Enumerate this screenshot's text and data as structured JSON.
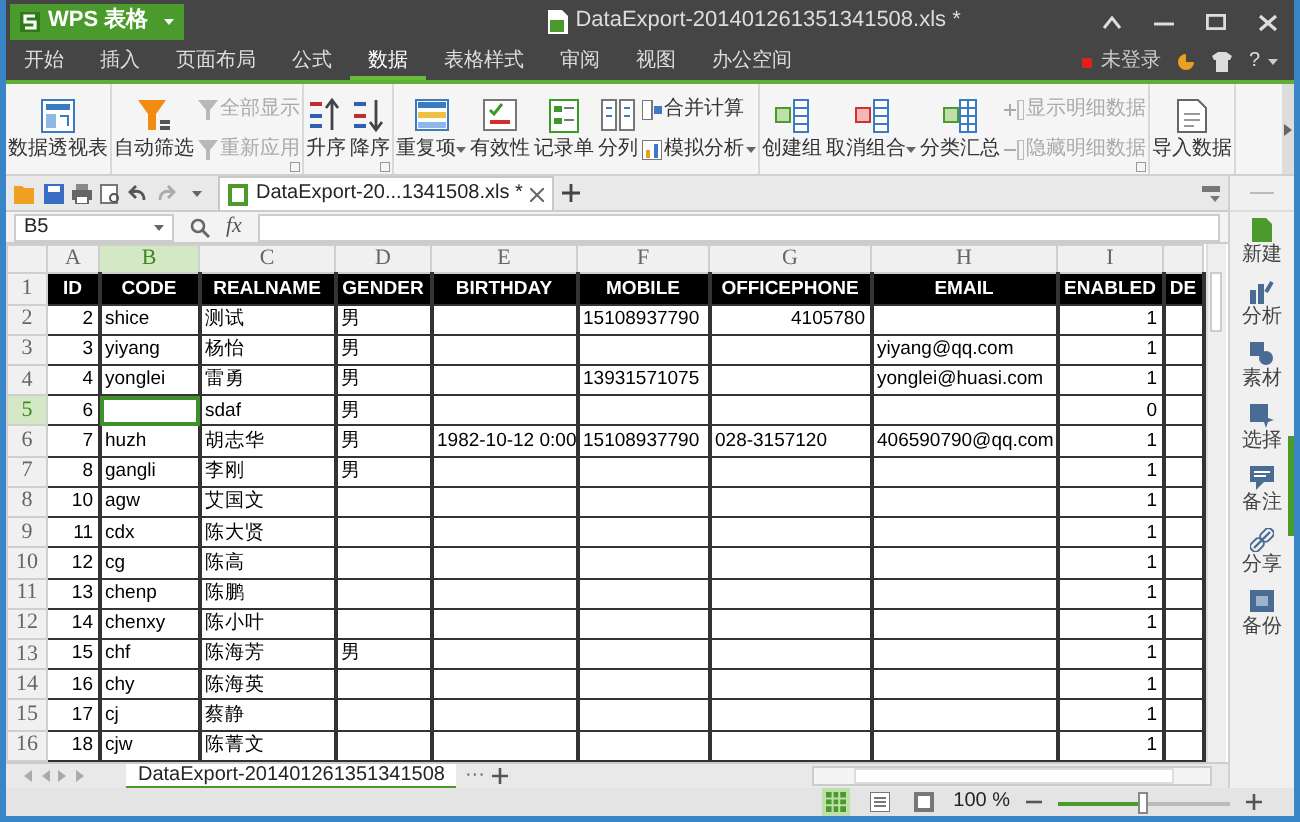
{
  "window": {
    "app_button": "WPS 表格",
    "title": "DataExport-201401261351341508.xls *"
  },
  "menu_tabs": [
    {
      "label": "开始",
      "selected": false
    },
    {
      "label": "插入",
      "selected": false
    },
    {
      "label": "页面布局",
      "selected": false
    },
    {
      "label": "公式",
      "selected": false
    },
    {
      "label": "数据",
      "selected": true
    },
    {
      "label": "表格样式",
      "selected": false
    },
    {
      "label": "审阅",
      "selected": false
    },
    {
      "label": "视图",
      "selected": false
    },
    {
      "label": "办公空间",
      "selected": false
    }
  ],
  "account": {
    "login": "未登录",
    "help": "?"
  },
  "ribbon": {
    "groups": [
      {
        "items": [
          {
            "label": "数据透视表",
            "kind": "large"
          }
        ]
      },
      {
        "launcher": true,
        "items": [
          {
            "label": "自动筛选",
            "kind": "large"
          },
          {
            "label": "全部显示",
            "kind": "small",
            "disabled": true
          },
          {
            "label": "重新应用",
            "kind": "small",
            "disabled": true
          }
        ]
      },
      {
        "launcher": true,
        "items": [
          {
            "label": "升序",
            "kind": "large"
          },
          {
            "label": "降序",
            "kind": "large"
          }
        ]
      },
      {
        "items": [
          {
            "label": "重复项",
            "kind": "large",
            "dropdown": true
          },
          {
            "label": "有效性",
            "kind": "large"
          },
          {
            "label": "记录单",
            "kind": "large"
          },
          {
            "label": "分列",
            "kind": "large"
          },
          {
            "label": "合并计算",
            "kind": "small"
          },
          {
            "label": "模拟分析",
            "kind": "small",
            "dropdown": true
          }
        ]
      },
      {
        "launcher": true,
        "items": [
          {
            "label": "创建组",
            "kind": "large"
          },
          {
            "label": "取消组合",
            "kind": "large",
            "dropdown": true
          },
          {
            "label": "分类汇总",
            "kind": "large"
          },
          {
            "label": "显示明细数据",
            "kind": "small",
            "disabled": true
          },
          {
            "label": "隐藏明细数据",
            "kind": "small",
            "disabled": true
          }
        ]
      },
      {
        "items": [
          {
            "label": "导入数据",
            "kind": "large"
          }
        ]
      }
    ]
  },
  "document_tab": {
    "title": "DataExport-20...1341508.xls *"
  },
  "formula_bar": {
    "cell": "B5",
    "fx": "fx"
  },
  "sheet": {
    "columns": [
      {
        "letter": "A",
        "kind": "number",
        "selected": false
      },
      {
        "letter": "B",
        "kind": "text",
        "selected": true
      },
      {
        "letter": "C",
        "kind": "text",
        "selected": false
      },
      {
        "letter": "D",
        "kind": "text",
        "selected": false
      },
      {
        "letter": "E",
        "kind": "number",
        "selected": false
      },
      {
        "letter": "F",
        "kind": "text",
        "selected": false
      },
      {
        "letter": "G",
        "kind": "text",
        "selected": false
      },
      {
        "letter": "H",
        "kind": "text",
        "selected": false
      },
      {
        "letter": "I",
        "kind": "number",
        "selected": false
      }
    ],
    "rows": [
      {
        "number": "1",
        "kind": "header",
        "selected": false,
        "cells": [
          "ID",
          "CODE",
          "REALNAME",
          "GENDER",
          "BIRTHDAY",
          "MOBILE",
          "OFFICEPHONE",
          "EMAIL",
          "ENABLED",
          "DE"
        ]
      },
      {
        "number": "2",
        "kind": "data",
        "selected": false,
        "cells": [
          "2",
          "shice",
          "测试",
          "男",
          null,
          "15108937790",
          {
            "text": "4105780",
            "kind": "number"
          },
          null,
          "1",
          null
        ]
      },
      {
        "number": "3",
        "kind": "data",
        "selected": false,
        "cells": [
          "3",
          "yiyang",
          "杨怡",
          "男",
          null,
          null,
          null,
          "yiyang@qq.com",
          "1",
          null
        ]
      },
      {
        "number": "4",
        "kind": "data",
        "selected": false,
        "cells": [
          "4",
          "yonglei",
          "雷勇",
          "男",
          null,
          "13931571075",
          null,
          "yonglei@huasi.com",
          "1",
          null
        ]
      },
      {
        "number": "5",
        "kind": "data",
        "selected": true,
        "cells": [
          "6",
          null,
          "sdaf",
          "男",
          null,
          null,
          null,
          null,
          "0",
          null
        ]
      },
      {
        "number": "6",
        "kind": "data",
        "selected": false,
        "cells": [
          "7",
          "huzh",
          "胡志华",
          "男",
          "1982-10-12 0:00",
          "15108937790",
          "028-3157120",
          "406590790@qq.com",
          "1",
          null
        ]
      },
      {
        "number": "7",
        "kind": "data",
        "selected": false,
        "cells": [
          "8",
          "gangli",
          "李刚",
          "男",
          null,
          null,
          null,
          null,
          "1",
          null
        ]
      },
      {
        "number": "8",
        "kind": "data",
        "selected": false,
        "cells": [
          "10",
          "agw",
          "艾国文",
          null,
          null,
          null,
          null,
          null,
          "1",
          null
        ]
      },
      {
        "number": "9",
        "kind": "data",
        "selected": false,
        "cells": [
          "11",
          "cdx",
          "陈大贤",
          null,
          null,
          null,
          null,
          null,
          "1",
          null
        ]
      },
      {
        "number": "10",
        "kind": "data",
        "selected": false,
        "cells": [
          "12",
          "cg",
          "陈高",
          null,
          null,
          null,
          null,
          null,
          "1",
          null
        ]
      },
      {
        "number": "11",
        "kind": "data",
        "selected": false,
        "cells": [
          "13",
          "chenp",
          "陈鹏",
          null,
          null,
          null,
          null,
          null,
          "1",
          null
        ]
      },
      {
        "number": "12",
        "kind": "data",
        "selected": false,
        "cells": [
          "14",
          "chenxy",
          "陈小叶",
          null,
          null,
          null,
          null,
          null,
          "1",
          null
        ]
      },
      {
        "number": "13",
        "kind": "data",
        "selected": false,
        "cells": [
          "15",
          "chf",
          "陈海芳",
          "男",
          null,
          null,
          null,
          null,
          "1",
          null
        ]
      },
      {
        "number": "14",
        "kind": "data",
        "selected": false,
        "cells": [
          "16",
          "chy",
          "陈海英",
          null,
          null,
          null,
          null,
          null,
          "1",
          null
        ]
      },
      {
        "number": "15",
        "kind": "data",
        "selected": false,
        "cells": [
          "17",
          "cj",
          "蔡静",
          null,
          null,
          null,
          null,
          null,
          "1",
          null
        ]
      },
      {
        "number": "16",
        "kind": "data",
        "selected": false,
        "cells": [
          "18",
          "cjw",
          "陈菁文",
          null,
          null,
          null,
          null,
          null,
          "1",
          null
        ]
      }
    ]
  },
  "sheet_tabs": [
    {
      "label": "DataExport-201401261351341508",
      "selected": true
    }
  ],
  "sheet_overflow": "···",
  "view_modes": [
    {
      "selected": true
    },
    {
      "selected": false
    },
    {
      "selected": false
    }
  ],
  "zoom": {
    "reading": "100 %",
    "level": 0.5
  },
  "side_panel": [
    {
      "label": "新建"
    },
    {
      "label": "分析"
    },
    {
      "label": "素材"
    },
    {
      "label": "选择"
    },
    {
      "label": "备注"
    },
    {
      "label": "分享"
    },
    {
      "label": "备份"
    }
  ]
}
